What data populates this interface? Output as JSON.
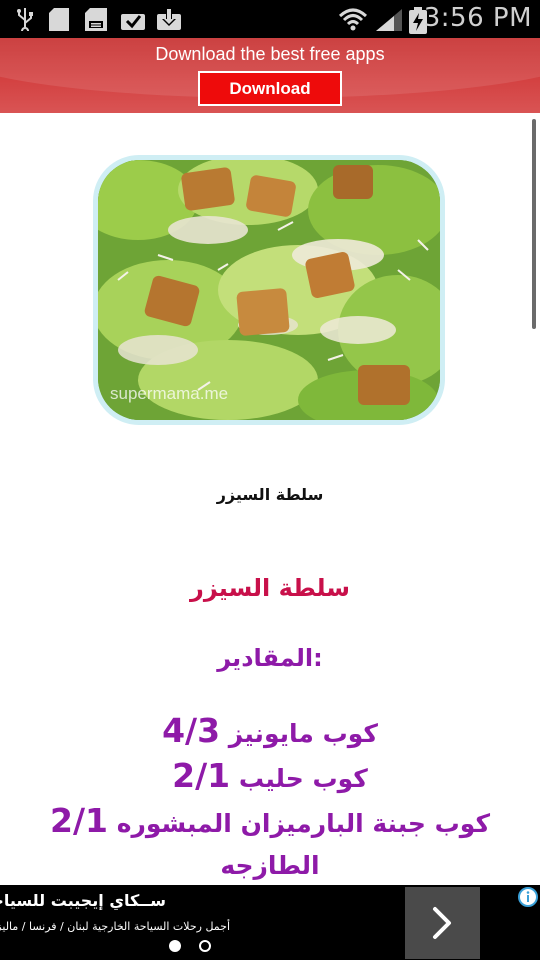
{
  "status_bar": {
    "time": "3:56 PM",
    "icons": [
      "usb-icon",
      "sd-card-icon",
      "sd-card-icon",
      "download-done-icon",
      "download-icon",
      "wifi-icon",
      "signal-icon",
      "battery-charging-icon"
    ]
  },
  "top_ad": {
    "text": "Download the best free apps",
    "button_label": "Download",
    "colors": {
      "background": "#cc3333",
      "button": "#ee0b0b"
    }
  },
  "article": {
    "image": {
      "watermark": "supermama.me",
      "subject": "caesar salad"
    },
    "caption": "سلطة السيزر",
    "heading": "سلطة السيزر",
    "subheading": "المقادير:",
    "ingredients": [
      {
        "amount": "4/3",
        "text": "كوب مايونيز"
      },
      {
        "amount": "2/1",
        "text": "كوب حليب"
      },
      {
        "amount": "2/1",
        "text": "كوب جبنة البارميزان المبشوره"
      }
    ],
    "ingredient_continuation": "الطازجه",
    "colors": {
      "heading": "#c8104a",
      "body": "#8e1aa8"
    }
  },
  "bottom_ad": {
    "title": "ســكاي إيجيبت للسياحة",
    "description": "أجمل رحلات السياحة الخارجية لبنان / فرنسا / ماليزيا",
    "pager": {
      "current": 1,
      "total": 2
    }
  }
}
